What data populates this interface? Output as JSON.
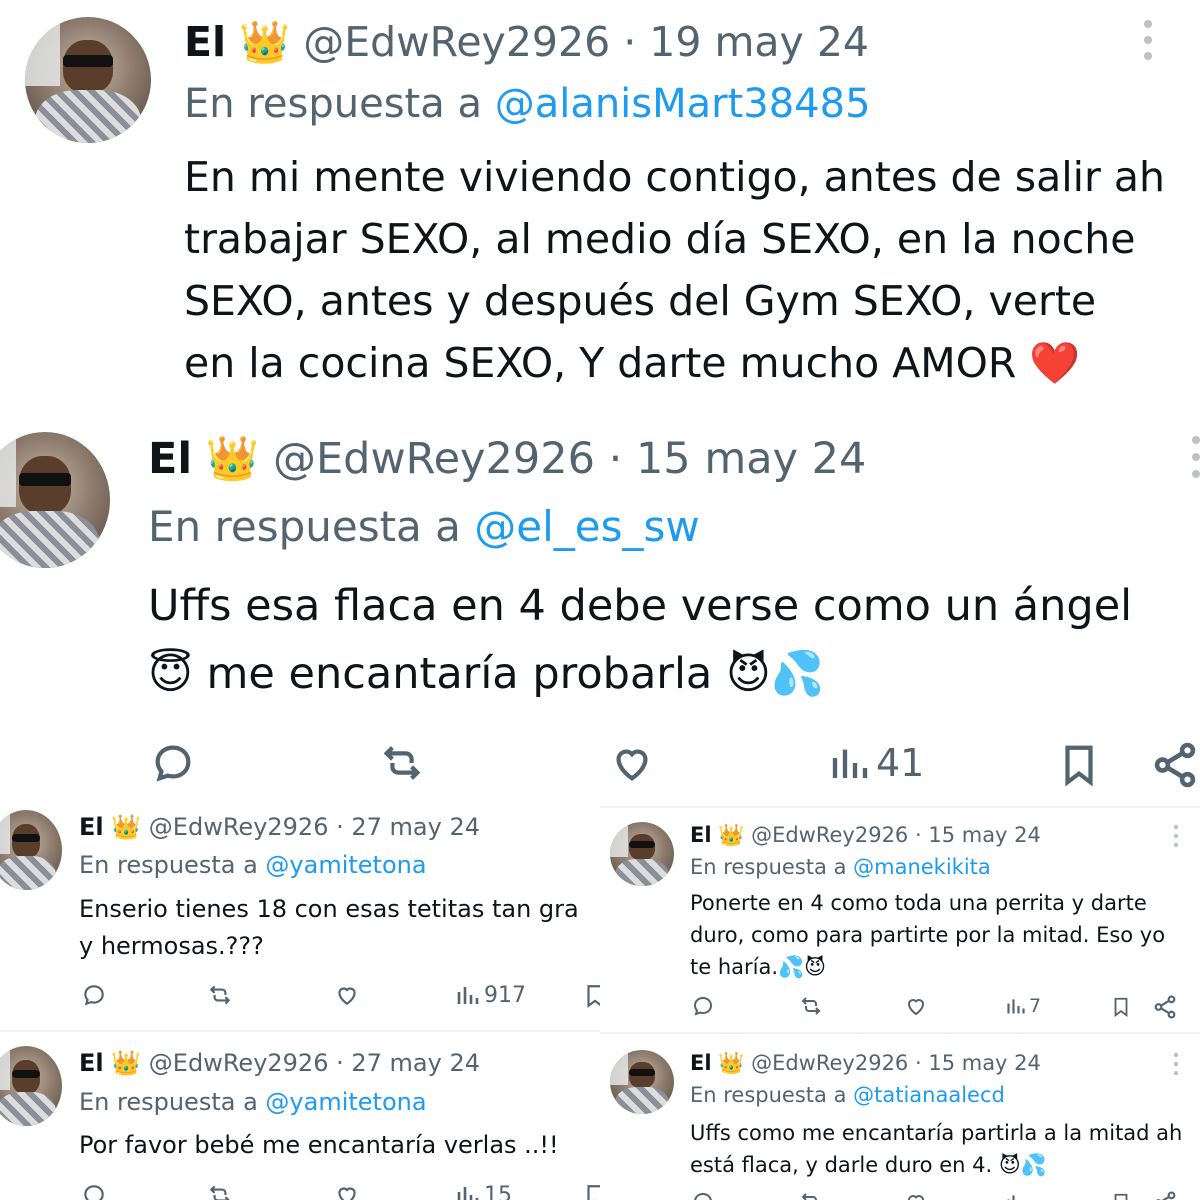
{
  "tweets": [
    {
      "name": "El",
      "crown": "👑",
      "handle": "@EdwRey2926",
      "date": "· 19 may 24",
      "reply_prefix": "En respuesta a",
      "reply_to": "@alanisMart38485",
      "body_lines": [
        "En mi mente viviendo contigo, antes de salir ah",
        "trabajar SEXO, al medio día SEXO, en la noche",
        "SEXO, antes y después del Gym SEXO, verte",
        "en la cocina SEXO, Y darte mucho AMOR ❤️"
      ],
      "more_icon": "more-vertical-icon"
    },
    {
      "name": "El",
      "crown": "👑",
      "handle": "@EdwRey2926",
      "date": "· 15 may 24",
      "reply_prefix": "En respuesta a",
      "reply_to": "@el_es_sw",
      "body_lines": [
        "Uffs esa flaca en 4 debe verse como un ángel",
        "😇 me encantaría probarla 😈💦"
      ],
      "views": "41",
      "more_icon": "more-vertical-icon"
    },
    {
      "name": "El",
      "crown": "👑",
      "handle": "@EdwRey2926",
      "date": "· 27 may 24",
      "reply_prefix": "En respuesta a",
      "reply_to": "@yamitetona",
      "body_lines": [
        "Enserio tienes 18 con esas tetitas tan gra",
        "y hermosas.???"
      ],
      "views": "917"
    },
    {
      "name": "El",
      "crown": "👑",
      "handle": "@EdwRey2926",
      "date": "· 15 may 24",
      "reply_prefix": "En respuesta a",
      "reply_to": "@manekikita",
      "body_lines": [
        "Ponerte en  4 como toda una perrita y darte",
        "duro, como para partirte por la mitad. Eso yo",
        "te haría.💦😈"
      ],
      "views": "7"
    },
    {
      "name": "El",
      "crown": "👑",
      "handle": "@EdwRey2926",
      "date": "· 27 may 24",
      "reply_prefix": "En respuesta a",
      "reply_to": "@yamitetona",
      "body_lines": [
        "Por favor bebé me encantaría verlas ..!!"
      ],
      "views": "15"
    },
    {
      "name": "El",
      "crown": "👑",
      "handle": "@EdwRey2926",
      "date": "· 15 may 24",
      "reply_prefix": "En respuesta a",
      "reply_to": "@tatianaalecd",
      "body_lines": [
        "Uffs como me encantaría partirla a la mitad ah",
        "está flaca, y darle duro en 4. 😈💦"
      ]
    }
  ],
  "colors": {
    "text": "#0f1419",
    "muted": "#536471",
    "link": "#1d9bf0",
    "divider": "#eff3f4"
  }
}
